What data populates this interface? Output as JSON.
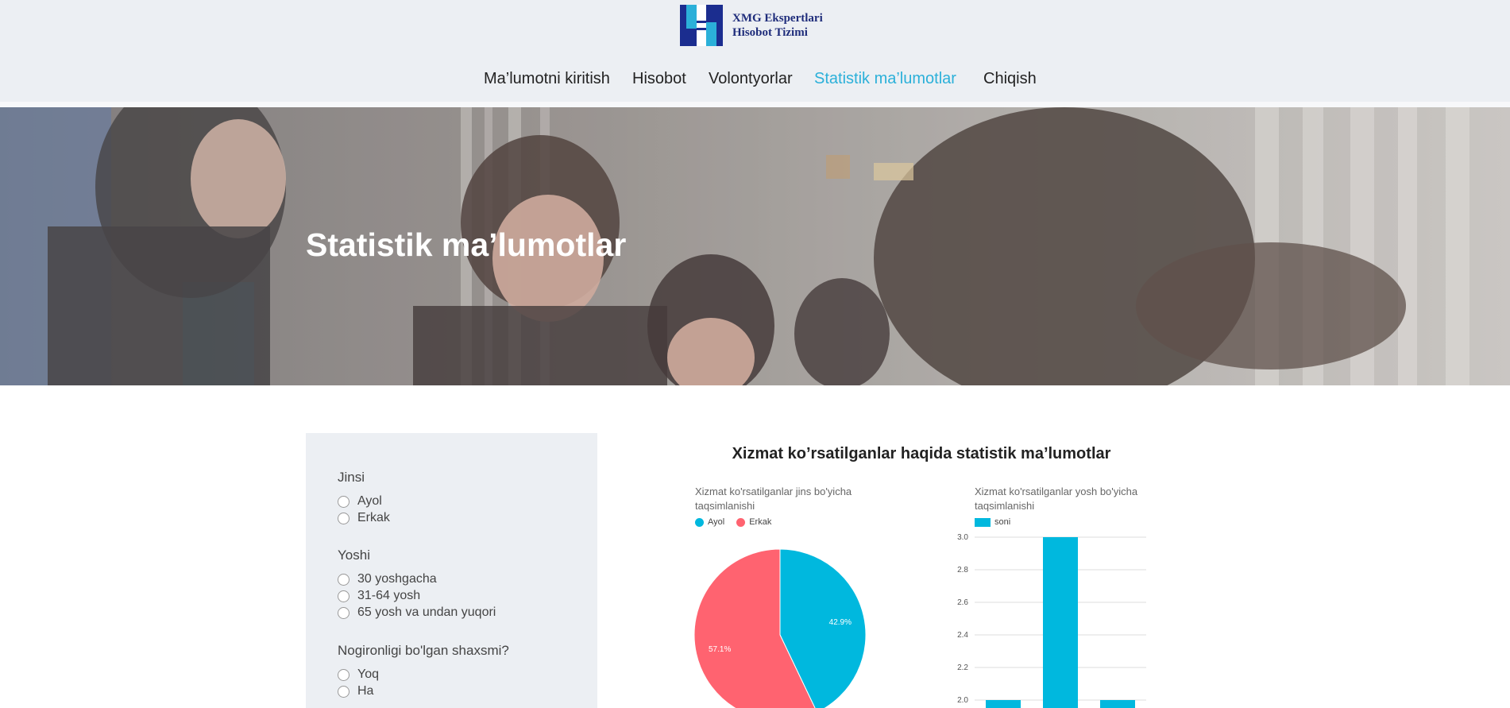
{
  "header": {
    "logo": {
      "line1": "XMG Ekspertlari",
      "line2": "Hisobot Tizimi",
      "primary_color": "#1b2d8f",
      "accent_color": "#2bb0d9"
    },
    "nav": [
      {
        "label": "Ma’lumotni kiritish",
        "active": false
      },
      {
        "label": "Hisobot",
        "active": false
      },
      {
        "label": "Volontyorlar",
        "active": false
      },
      {
        "label": "Statistik ma’lumotlar",
        "active": true
      },
      {
        "label": "Chiqish",
        "active": false
      }
    ]
  },
  "hero": {
    "title": "Statistik ma’lumotlar"
  },
  "filters": {
    "groups": [
      {
        "title": "Jinsi",
        "options": [
          "Ayol",
          "Erkak"
        ]
      },
      {
        "title": "Yoshi",
        "options": [
          "30 yoshgacha",
          "31-64 yosh",
          "65 yosh va undan yuqori"
        ]
      },
      {
        "title": "Nogironligi bo'lgan shaxsmi?",
        "options": [
          "Yoq",
          "Ha"
        ]
      }
    ]
  },
  "stats": {
    "title": "Xizmat ko’rsatilganlar haqida statistik ma’lumotlar"
  },
  "chart_data": [
    {
      "type": "pie",
      "title": "Xizmat ko'rsatilganlar jins bo'yicha taqsimlanishi",
      "labels": [
        "Ayol",
        "Erkak"
      ],
      "values": [
        42.9,
        57.1
      ],
      "value_labels": [
        "42.9%",
        "57.1%"
      ],
      "colors": [
        "#00b8de",
        "#ff6370"
      ],
      "legend": "top"
    },
    {
      "type": "bar",
      "title": "Xizmat ko'rsatilganlar yosh bo'yicha taqsimlanishi",
      "series": [
        {
          "name": "soni",
          "values": [
            2,
            3,
            2
          ]
        }
      ],
      "yticks": [
        "3.0",
        "2.8",
        "2.6",
        "2.4",
        "2.2",
        "2.0"
      ],
      "ylim": [
        2.0,
        3.0
      ],
      "color": "#00b8de",
      "legend": "top",
      "grid": true
    }
  ]
}
